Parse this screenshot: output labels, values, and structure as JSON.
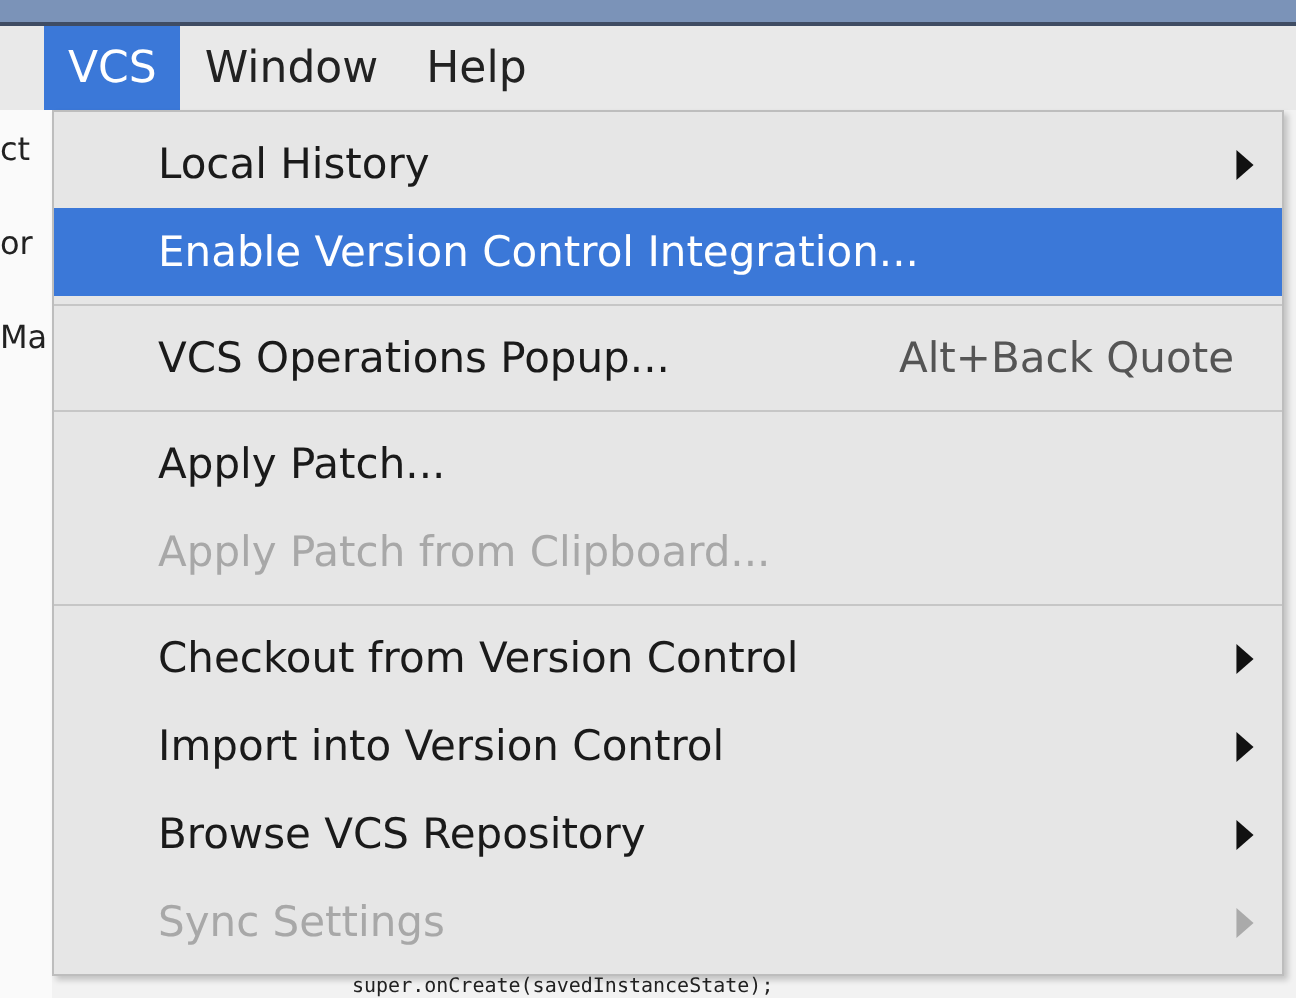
{
  "menubar": [
    {
      "label": "VCS",
      "selected": true
    },
    {
      "label": "Window",
      "selected": false
    },
    {
      "label": "Help",
      "selected": false
    }
  ],
  "background": {
    "fragments": [
      "ct",
      "or",
      "Ma"
    ],
    "code_line": "super.onCreate(savedInstanceState);"
  },
  "menu": [
    {
      "kind": "item",
      "label": "Local History",
      "selected": false,
      "disabled": false,
      "submenu": true
    },
    {
      "kind": "item",
      "label": "Enable Version Control Integration...",
      "selected": true,
      "disabled": false,
      "submenu": false
    },
    {
      "kind": "separator"
    },
    {
      "kind": "item",
      "label": "VCS Operations Popup...",
      "shortcut": "Alt+Back Quote",
      "selected": false,
      "disabled": false,
      "submenu": false
    },
    {
      "kind": "separator"
    },
    {
      "kind": "item",
      "label": "Apply Patch...",
      "selected": false,
      "disabled": false,
      "submenu": false
    },
    {
      "kind": "item",
      "label": "Apply Patch from Clipboard...",
      "selected": false,
      "disabled": true,
      "submenu": false
    },
    {
      "kind": "separator"
    },
    {
      "kind": "item",
      "label": "Checkout from Version Control",
      "selected": false,
      "disabled": false,
      "submenu": true
    },
    {
      "kind": "item",
      "label": "Import into Version Control",
      "selected": false,
      "disabled": false,
      "submenu": true
    },
    {
      "kind": "item",
      "label": "Browse VCS Repository",
      "selected": false,
      "disabled": false,
      "submenu": true
    },
    {
      "kind": "item",
      "label": "Sync Settings",
      "selected": false,
      "disabled": true,
      "submenu": true
    }
  ]
}
